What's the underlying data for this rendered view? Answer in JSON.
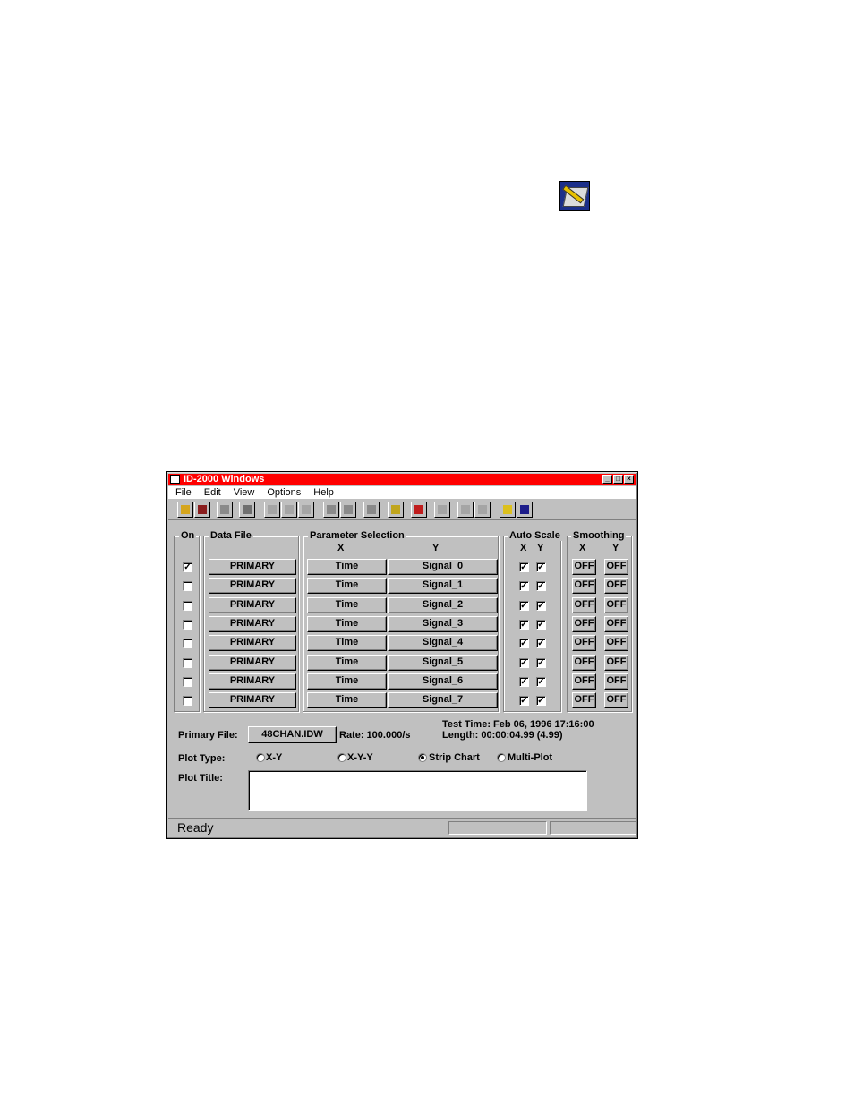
{
  "window": {
    "title": "ID-2000 Windows",
    "title_color": "#ff0000",
    "controls": {
      "minimize": "_",
      "maximize": "□",
      "close": "×"
    }
  },
  "menu": [
    "File",
    "Edit",
    "View",
    "Options",
    "Help"
  ],
  "toolbar_icons": [
    "open-folder-icon",
    "save-icon",
    "copy-icon",
    "print-icon",
    "plot-xy-icon",
    "plot-line-icon",
    "fft-icon",
    "zoom-in-icon",
    "zoom-100-icon",
    "report-icon",
    "list-icon",
    "record-icon",
    "hand-icon",
    "cursor-a-icon",
    "cursor-b-icon",
    "help-icon",
    "context-help-icon"
  ],
  "groups": {
    "on": "On",
    "data_file": "Data File",
    "parameter_selection": "Parameter Selection",
    "auto_scale": "Auto Scale",
    "smoothing": "Smoothing"
  },
  "headers": {
    "x": "X",
    "y": "Y"
  },
  "rows": [
    {
      "on": true,
      "file": "PRIMARY",
      "x": "Time",
      "y": "Signal_0",
      "auto_x": true,
      "auto_y": true,
      "smooth_x": "OFF",
      "smooth_y": "OFF"
    },
    {
      "on": false,
      "file": "PRIMARY",
      "x": "Time",
      "y": "Signal_1",
      "auto_x": true,
      "auto_y": true,
      "smooth_x": "OFF",
      "smooth_y": "OFF"
    },
    {
      "on": false,
      "file": "PRIMARY",
      "x": "Time",
      "y": "Signal_2",
      "auto_x": true,
      "auto_y": true,
      "smooth_x": "OFF",
      "smooth_y": "OFF"
    },
    {
      "on": false,
      "file": "PRIMARY",
      "x": "Time",
      "y": "Signal_3",
      "auto_x": true,
      "auto_y": true,
      "smooth_x": "OFF",
      "smooth_y": "OFF"
    },
    {
      "on": false,
      "file": "PRIMARY",
      "x": "Time",
      "y": "Signal_4",
      "auto_x": true,
      "auto_y": true,
      "smooth_x": "OFF",
      "smooth_y": "OFF"
    },
    {
      "on": false,
      "file": "PRIMARY",
      "x": "Time",
      "y": "Signal_5",
      "auto_x": true,
      "auto_y": true,
      "smooth_x": "OFF",
      "smooth_y": "OFF"
    },
    {
      "on": false,
      "file": "PRIMARY",
      "x": "Time",
      "y": "Signal_6",
      "auto_x": true,
      "auto_y": true,
      "smooth_x": "OFF",
      "smooth_y": "OFF"
    },
    {
      "on": false,
      "file": "PRIMARY",
      "x": "Time",
      "y": "Signal_7",
      "auto_x": true,
      "auto_y": true,
      "smooth_x": "OFF",
      "smooth_y": "OFF"
    }
  ],
  "primary_file": {
    "label": "Primary File:",
    "value": "48CHAN.IDW",
    "rate": "Rate: 100.000/s",
    "test_time": "Test Time: Feb 06, 1996  17:16:00",
    "length": "Length: 00:00:04.99  (4.99)"
  },
  "plot_type": {
    "label": "Plot Type:",
    "options": [
      "X-Y",
      "X-Y-Y",
      "Strip Chart",
      "Multi-Plot"
    ],
    "selected": "Strip Chart"
  },
  "plot_title": {
    "label": "Plot Title:",
    "value": ""
  },
  "status": {
    "text": "Ready"
  }
}
